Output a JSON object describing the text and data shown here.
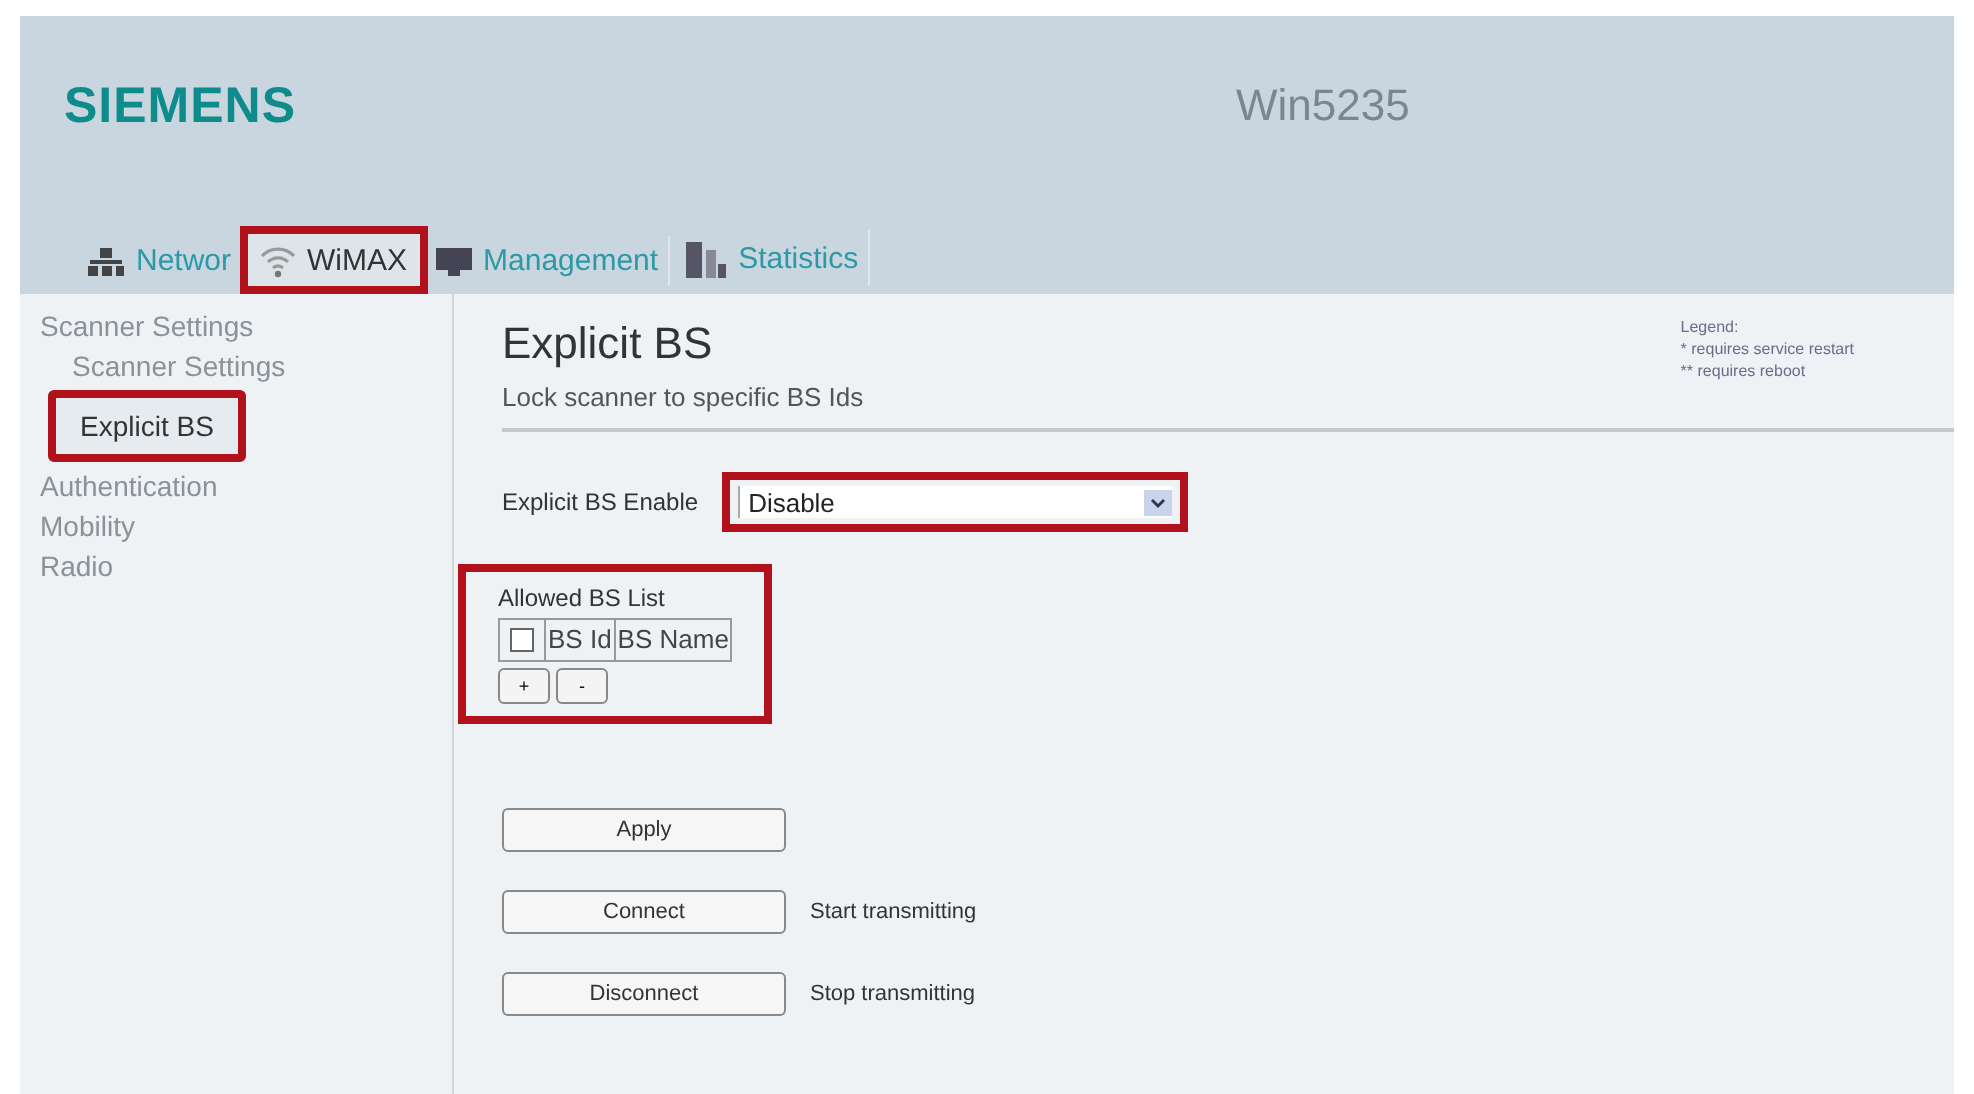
{
  "header": {
    "logo": "SIEMENS",
    "device": "Win5235"
  },
  "tabs": [
    {
      "label": "Networ",
      "selected": false,
      "highlighted": false
    },
    {
      "label": "WiMAX",
      "selected": true,
      "highlighted": true
    },
    {
      "label": "Management",
      "selected": false,
      "highlighted": false
    },
    {
      "label": "Statistics",
      "selected": false,
      "highlighted": false
    }
  ],
  "sidebar": {
    "items": [
      {
        "label": "Scanner Settings",
        "selected": false,
        "highlighted": false,
        "children": [
          {
            "label": "Scanner Settings",
            "selected": false,
            "highlighted": false
          },
          {
            "label": "Explicit BS",
            "selected": true,
            "highlighted": true
          }
        ]
      },
      {
        "label": "Authentication",
        "selected": false,
        "highlighted": false
      },
      {
        "label": "Mobility",
        "selected": false,
        "highlighted": false
      },
      {
        "label": "Radio",
        "selected": false,
        "highlighted": false
      }
    ]
  },
  "page": {
    "title": "Explicit BS",
    "subtitle": "Lock scanner to specific BS Ids"
  },
  "legend": {
    "title": "Legend:",
    "items": [
      {
        "mark": "*",
        "text": "requires service restart"
      },
      {
        "mark": "**",
        "text": "requires reboot"
      }
    ]
  },
  "enable": {
    "label": "Explicit BS Enable",
    "value": "Disable",
    "highlighted": true
  },
  "bs_list": {
    "title": "Allowed BS List",
    "checked": false,
    "columns": [
      "BS Id",
      "BS Name"
    ],
    "add": "+",
    "remove": "-",
    "highlighted": true
  },
  "actions": [
    {
      "label": "Apply"
    },
    {
      "label": "Connect",
      "note": "Start transmitting"
    },
    {
      "label": "Disconnect",
      "note": "Stop transmitting"
    }
  ]
}
